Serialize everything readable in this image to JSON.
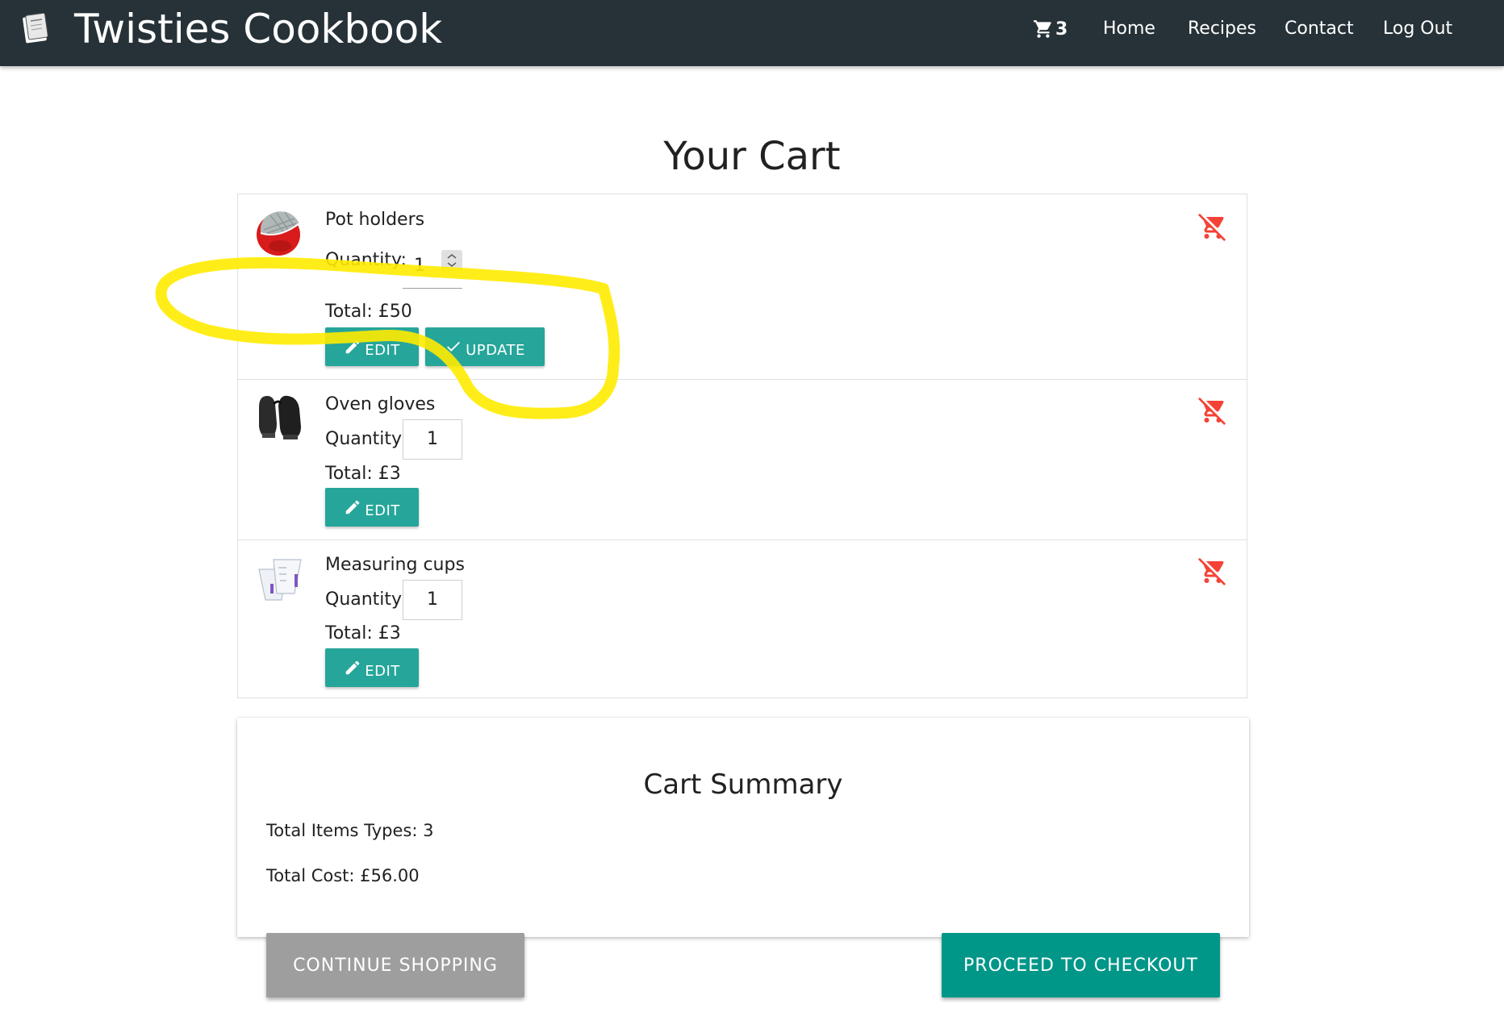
{
  "navbar": {
    "brand_title": "Twisties Cookbook",
    "cart_count": "3",
    "links": [
      "Home",
      "Recipes",
      "Contact",
      "Log Out"
    ],
    "background": "#263238"
  },
  "page": {
    "title": "Your Cart"
  },
  "cart": {
    "items": [
      {
        "name": "Pot holders",
        "quantity_label": "Quantity:",
        "quantity": "1",
        "total": "Total: £50",
        "edit_label": "EDIT",
        "update_label": "UPDATE",
        "image": "red-pot-holder-image",
        "editing": true
      },
      {
        "name": "Oven gloves",
        "quantity_label": "Quantity:",
        "quantity": "1",
        "total": "Total: £3",
        "edit_label": "EDIT",
        "image": "black-oven-gloves-image",
        "editing": false
      },
      {
        "name": "Measuring cups",
        "quantity_label": "Quantity:",
        "quantity": "1",
        "total": "Total: £3",
        "edit_label": "EDIT",
        "image": "measuring-cups-image",
        "editing": false
      }
    ],
    "remove_icon": "remove-shopping-cart-icon"
  },
  "summary": {
    "title": "Cart Summary",
    "total_item_types": "Total Items Types: 3",
    "total_cost": "Total Cost: £56.00"
  },
  "actions": {
    "continue_label": "CONTINUE SHOPPING",
    "checkout_label": "PROCEED TO CHECKOUT"
  },
  "colors": {
    "accent": "#26a69a",
    "checkout": "#009688",
    "continue": "#9e9e9e",
    "remove": "#f44336",
    "annotation": "#ffeb00"
  }
}
